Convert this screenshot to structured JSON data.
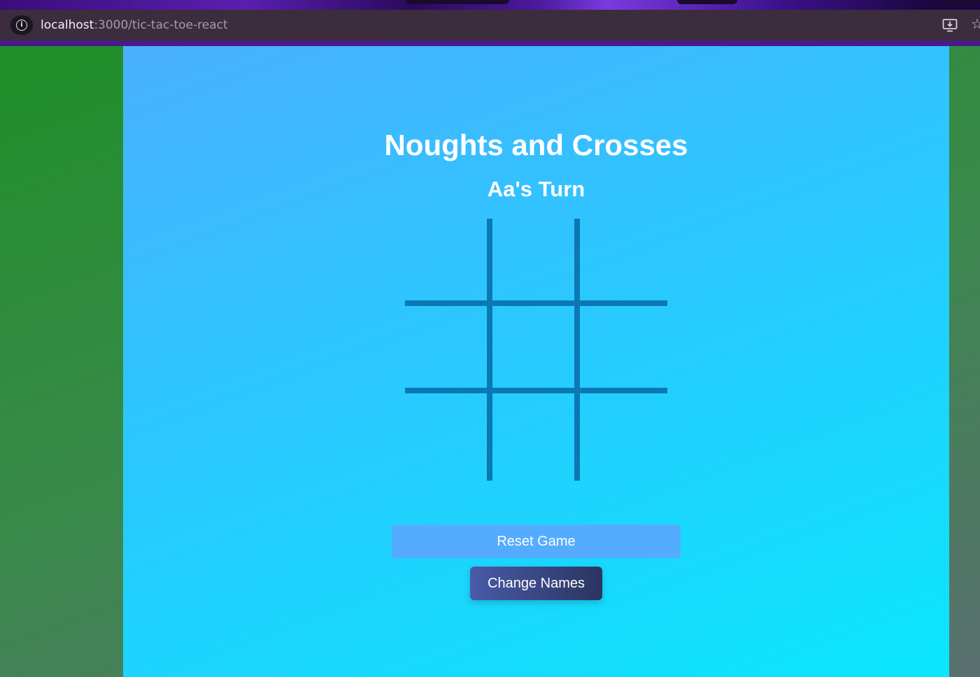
{
  "browser": {
    "url_host": "localhost",
    "url_path": ":3000/tic-tac-toe-react"
  },
  "game": {
    "title": "Noughts and Crosses",
    "turn_text": "Aa's Turn",
    "board": [
      "",
      "",
      "",
      "",
      "",
      "",
      "",
      "",
      ""
    ]
  },
  "buttons": {
    "reset_label": "Reset Game",
    "change_names_label": "Change Names"
  },
  "colors": {
    "grid_line": "#0b78b4",
    "reset_button": "#55acff",
    "change_names_button": "#2a3560",
    "text": "#ffffff"
  }
}
